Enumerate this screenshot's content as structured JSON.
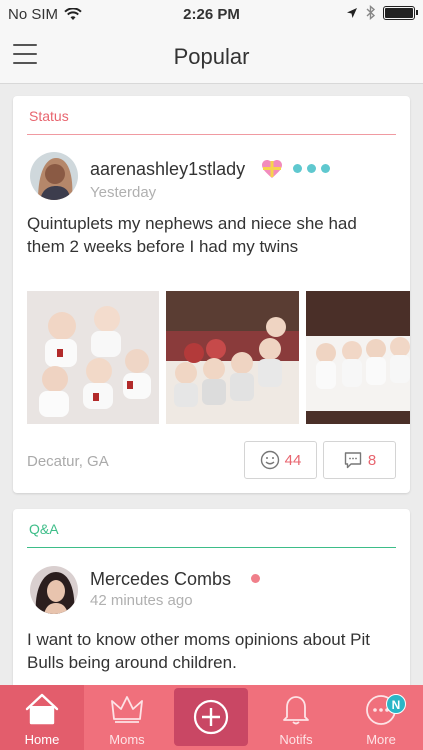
{
  "status_bar": {
    "carrier": "No SIM",
    "time": "2:26 PM"
  },
  "header": {
    "title": "Popular"
  },
  "feed": [
    {
      "type_label": "Status",
      "type_color": "#e8656f",
      "username": "aarenashley1stlady",
      "time": "Yesterday",
      "text": "Quintuplets my nephews and niece she had them 2 weeks before I had my twins",
      "location": "Decatur, GA",
      "likes": "44",
      "comments": "8"
    },
    {
      "type_label": "Q&A",
      "type_color": "#3dbd88",
      "username": "Mercedes Combs",
      "time": "42 minutes ago",
      "text": "I want to know other moms opinions about Pit Bulls being around children."
    }
  ],
  "tab_bar": {
    "background": "#f0707c",
    "add_background": "#c94764",
    "tabs": [
      {
        "label": "Home",
        "icon": "house-icon",
        "active": true
      },
      {
        "label": "Moms",
        "icon": "crown-icon",
        "active": false
      },
      {
        "label": "",
        "icon": "plus-circle-icon",
        "active": false
      },
      {
        "label": "Notifs",
        "icon": "bell-icon",
        "active": false
      },
      {
        "label": "More",
        "icon": "ellipsis-circle-icon",
        "active": false
      }
    ],
    "more_badge": "N",
    "badge_color": "#2bb6c6"
  },
  "colors": {
    "accent_teal": "#5fc8cf",
    "dot_pink": "#f07f8a",
    "count_pink": "#e8656f"
  }
}
